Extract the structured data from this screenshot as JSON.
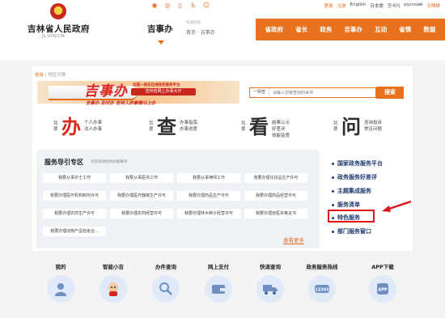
{
  "topbar": {
    "links": [
      "登录",
      "注册",
      "English",
      "日本語",
      "한국어",
      "русский",
      "无障碍"
    ]
  },
  "header": {
    "gov_name": "吉林省人民政府",
    "gov_url": "JL.GOV.CN",
    "section": "吉事办",
    "breadcrumb_hint": "快速链接",
    "breadcrumb": "首页 · 吉事办",
    "nav": [
      "省政府",
      "省长",
      "政务",
      "吉事办",
      "互动",
      "省情",
      "数据"
    ]
  },
  "sublocation": {
    "current": "省级",
    "switch": "地区切换"
  },
  "banner": {
    "logo": "吉事办",
    "line1": "全国一体化在线政务服务平台",
    "ribbon": "吉林省网上办事大厅",
    "slogan": "吉事办  及时办  吉林人的事情马上办"
  },
  "search": {
    "scope": "一网查",
    "placeholder": "请输入您要查找的事项",
    "button": "搜索"
  },
  "quick": [
    {
      "pre": "我要",
      "big": "办",
      "items": [
        "个人办事",
        "法人办事"
      ]
    },
    {
      "pre": "我要",
      "big": "查",
      "items": [
        "办事指南",
        "办事进度"
      ]
    },
    {
      "pre": "我要",
      "big": "看",
      "items": [
        "结果公示",
        "好差评",
        "效能监督"
      ]
    },
    {
      "pre": "我要",
      "big": "问",
      "items": [
        "咨询投诉",
        "常见问题"
      ]
    }
  ],
  "guide": {
    "title": "服务导引专区",
    "hint": "为您快速找到办理事项",
    "items": [
      "我要从事护士工作",
      "我要从事医师工作",
      "我要从事律师工作",
      "我要办理化妆品生产许可",
      "我要办理医疗机构制剂许可",
      "我要办理医疗器械生产许可",
      "我要办理药品生产许可",
      "我要办理药品经营许可",
      "我要办理农药生产许可",
      "我要办理农药经营许可",
      "我要办理林木种子经营许可",
      "我要办理兽医资格证书",
      "我要办理动物产品检疫合..."
    ],
    "more": "查看更多"
  },
  "right_links": [
    "国家政务服务平台",
    "政务服务好差评",
    "主题集成服务",
    "服务清单",
    "特色服务",
    "部门服务窗口"
  ],
  "services": [
    {
      "label": "我的",
      "icon": "user-icon"
    },
    {
      "label": "智能小吉",
      "icon": "robot-icon"
    },
    {
      "label": "办件查询",
      "icon": "search-person-icon"
    },
    {
      "label": "网上支付",
      "icon": "wallet-icon"
    },
    {
      "label": "快递查询",
      "icon": "truck-icon"
    },
    {
      "label": "政务服务热线",
      "icon": "hotline-icon"
    },
    {
      "label": "APP下载",
      "icon": "app-icon"
    }
  ],
  "hotline_number": "12345",
  "app_badge": "APP",
  "colors": {
    "accent": "#e7711d",
    "red": "#d9251b",
    "navy": "#1f3a70"
  }
}
